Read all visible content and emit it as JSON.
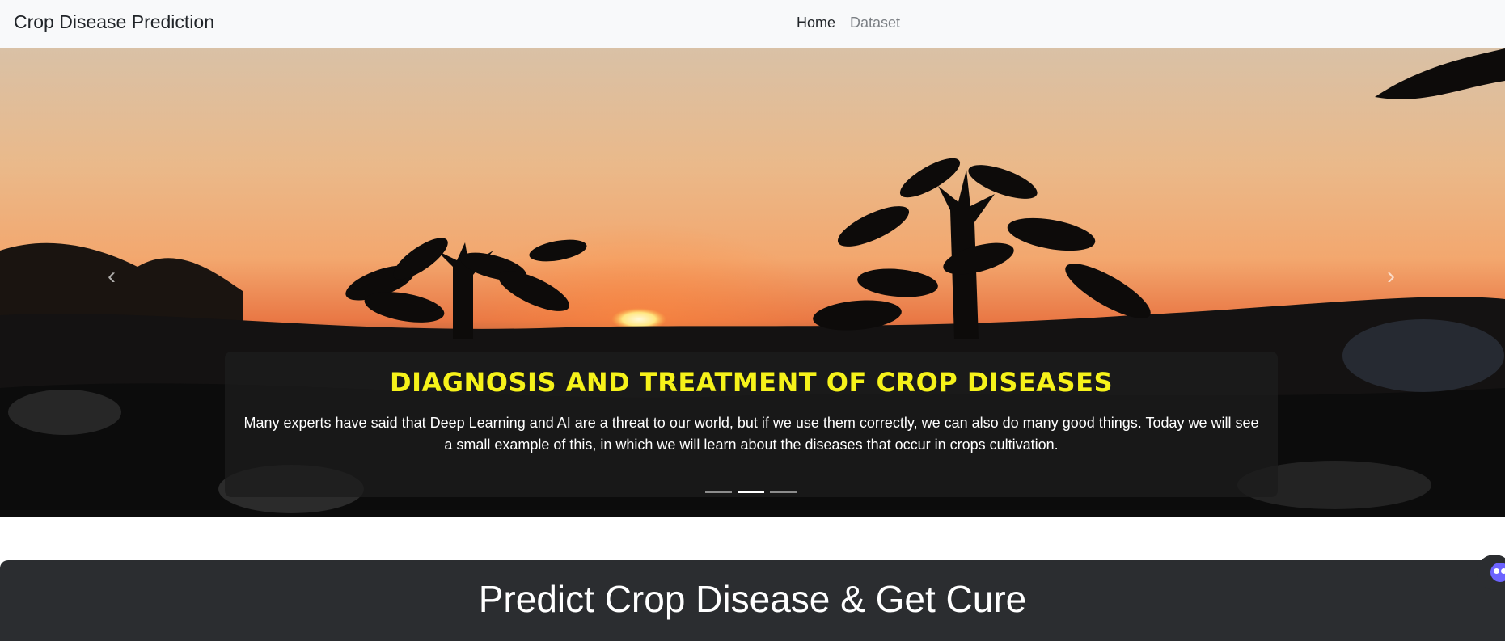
{
  "navbar": {
    "brand": "Crop Disease Prediction",
    "links": [
      {
        "label": "Home",
        "active": true
      },
      {
        "label": "Dataset",
        "active": false
      }
    ]
  },
  "carousel": {
    "slide_count": 3,
    "active_index": 1,
    "caption_title": "DIAGNOSIS AND TREATMENT OF CROP DISEASES",
    "caption_text": "Many experts have said that Deep Learning and AI are a threat to our world, but if we use them correctly, we can also do many good things. Today we will see a small example of this, in which we will learn about the diseases that occur in crops cultivation.",
    "prev_icon": "chevron-left-icon",
    "next_icon": "chevron-right-icon",
    "image": "sunset-crop-silhouette"
  },
  "jumbotron": {
    "title": "Predict Crop Disease & Get Cure"
  },
  "colors": {
    "navbar_bg": "#f8f9fa",
    "caption_title": "#f6f21a",
    "jumbotron_bg": "#2b2d30"
  },
  "widget": {
    "icon": "chat-bot-icon"
  }
}
